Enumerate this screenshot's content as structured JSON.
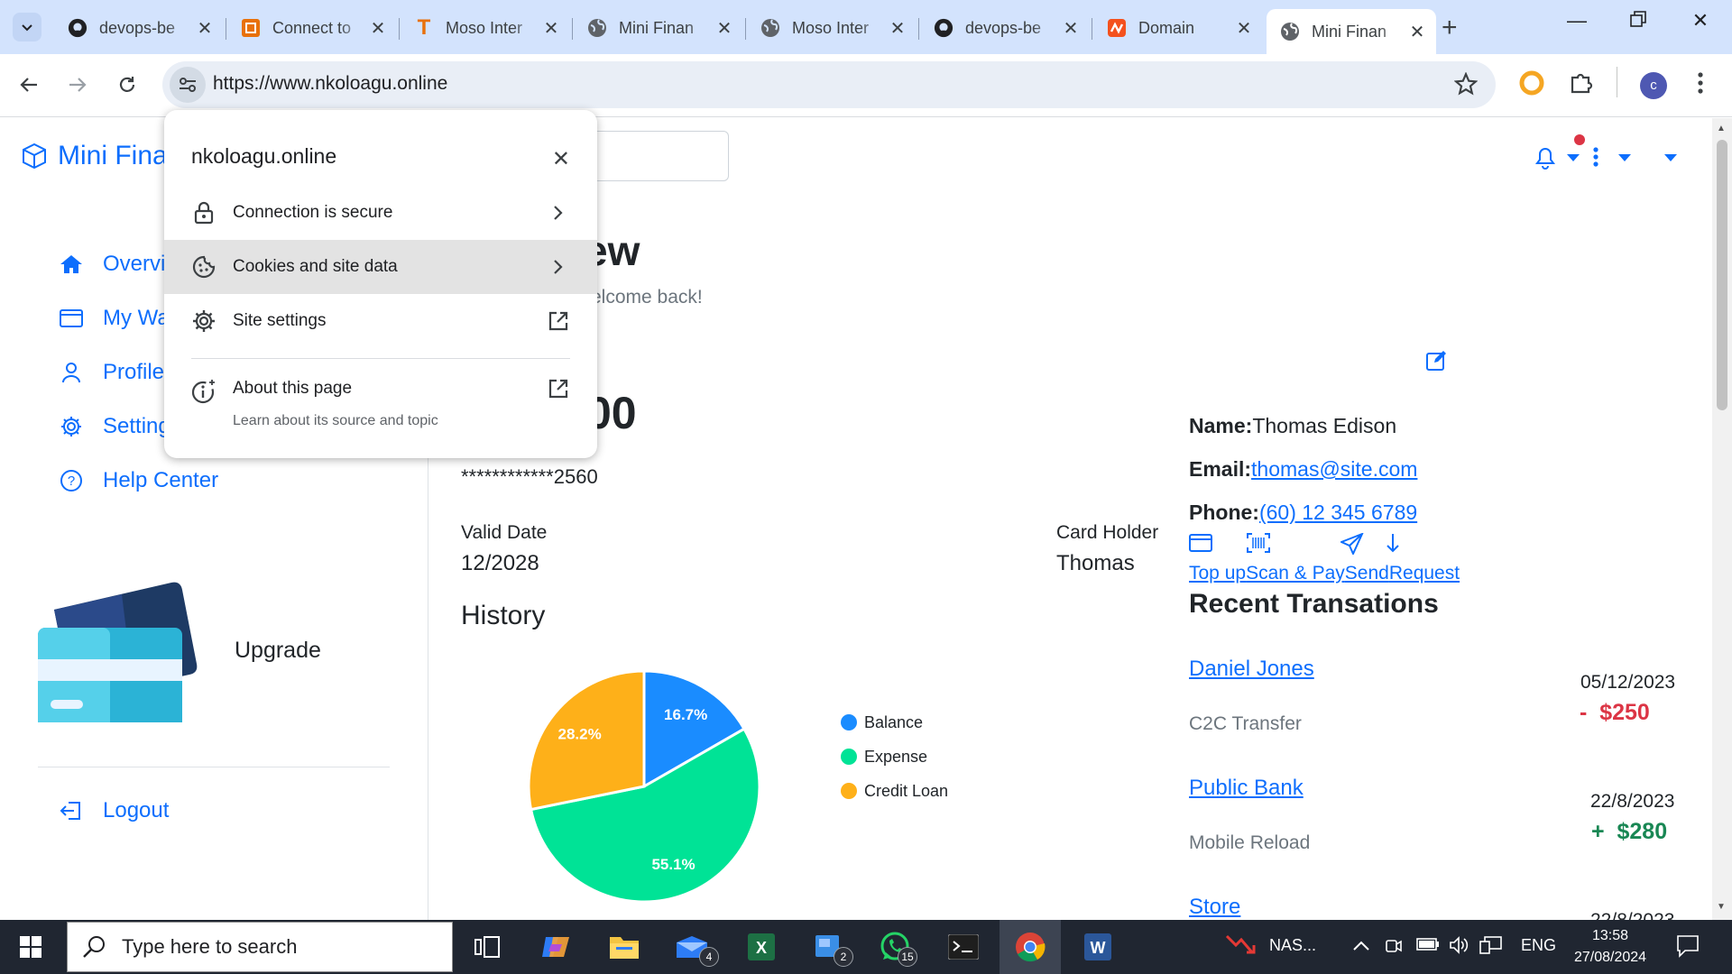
{
  "browser": {
    "tabs": [
      {
        "title": "devops-be",
        "favicon": "github-icon"
      },
      {
        "title": "Connect to",
        "favicon": "orange-square-icon"
      },
      {
        "title": "Moso Inter",
        "favicon": "letter-t-icon"
      },
      {
        "title": "Mini Finan",
        "favicon": "globe-icon"
      },
      {
        "title": "Moso Inter",
        "favicon": "globe-icon"
      },
      {
        "title": "devops-be",
        "favicon": "github-icon"
      },
      {
        "title": "Domain",
        "favicon": "namecheap-icon"
      },
      {
        "title": "Mini Finan",
        "favicon": "globe-icon",
        "active": true
      }
    ],
    "url": "https://www.nkoloagu.online",
    "profile_initial": "c"
  },
  "site": {
    "brand": "Mini Fina",
    "nav": [
      {
        "label": "Overvie",
        "icon": "home-icon"
      },
      {
        "label": "My Wa",
        "icon": "wallet-icon"
      },
      {
        "label": "Profile",
        "icon": "person-icon"
      },
      {
        "label": "Setting",
        "icon": "gear-icon"
      },
      {
        "label": "Help Center",
        "icon": "help-circle-icon"
      }
    ],
    "upgrade_label": "Upgrade",
    "logout_label": "Logout",
    "heading": "ew",
    "subheading": "elcome back!",
    "balance": "00",
    "card_number": "************2560",
    "valid_date_label": "Valid Date",
    "valid_date": "12/2028",
    "card_holder_label": "Card Holder",
    "card_holder": "Thomas",
    "history_title": "History",
    "profile": {
      "name_label": "Name:",
      "name": "Thomas Edison",
      "email_label": "Email:",
      "email": "thomas@site.com",
      "phone_label": "Phone:",
      "phone": "(60) 12 345 6789"
    },
    "actions": [
      "Top up",
      "Scan & Pay",
      "Send",
      "Request"
    ],
    "recent_title": "Recent Transations",
    "transactions": [
      {
        "name": "Daniel Jones",
        "type": "C2C Transfer",
        "date": "05/12/2023",
        "amount": "-  $250",
        "color": "#dc3545"
      },
      {
        "name": "Public Bank",
        "type": "Mobile Reload",
        "date": "22/8/2023",
        "amount": "+  $280",
        "color": "#198754"
      },
      {
        "name": "Store",
        "type": "",
        "date": "22/8/2023",
        "amount": "",
        "color": "#212529"
      }
    ]
  },
  "chart_data": {
    "type": "pie",
    "title": "History",
    "slices": [
      {
        "name": "Balance",
        "value": 16.7,
        "label": "16.7%",
        "color": "#1a8cff"
      },
      {
        "name": "Expense",
        "value": 55.1,
        "label": "55.1%",
        "color": "#00e396"
      },
      {
        "name": "Credit Loan",
        "value": 28.2,
        "label": "28.2%",
        "color": "#feb019"
      }
    ],
    "legend_position": "right"
  },
  "popup": {
    "host": "nkoloagu.online",
    "items": [
      {
        "label": "Connection is secure",
        "icon": "lock-icon"
      },
      {
        "label": "Cookies and site data",
        "icon": "cookie-icon"
      },
      {
        "label": "Site settings",
        "icon": "gear-icon"
      },
      {
        "label": "About this page",
        "icon": "info-sparkle-icon"
      }
    ],
    "about_sub": "Learn about its source and topic"
  },
  "taskbar": {
    "search_placeholder": "Type here to search",
    "badges": {
      "mail": "4",
      "app2": "2",
      "whatsapp": "15"
    },
    "tray_app": "NAS...",
    "language": "ENG",
    "time": "13:58",
    "date": "27/08/2024"
  }
}
